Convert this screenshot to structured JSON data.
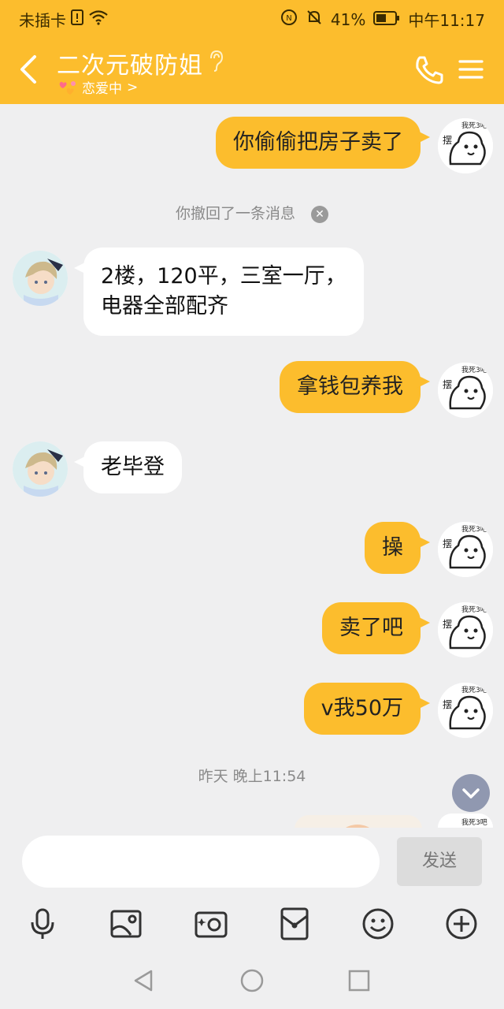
{
  "status_bar": {
    "carrier": "未插卡",
    "battery_pct": "41%",
    "time": "中午11:17"
  },
  "header": {
    "title": "二次元破防姐",
    "status": "恋爱中",
    "status_chevron": ">"
  },
  "messages": [
    {
      "side": "me",
      "text": "你偷偷把房子卖了"
    },
    {
      "side": "system",
      "text": "你撤回了一条消息"
    },
    {
      "side": "other",
      "line1": "2楼，120平，三室一厅，",
      "line2": "电器全部配齐"
    },
    {
      "side": "me",
      "text": "拿钱包养我"
    },
    {
      "side": "other",
      "text": "老毕登"
    },
    {
      "side": "me",
      "text": "操"
    },
    {
      "side": "me",
      "text": "卖了吧"
    },
    {
      "side": "me",
      "text": "v我50万"
    },
    {
      "side": "system",
      "text": "昨天 晚上11:54"
    }
  ],
  "input": {
    "placeholder": "",
    "send_label": "发送"
  },
  "toolbar_icons": [
    "microphone-icon",
    "image-icon",
    "camera-icon",
    "red-packet-icon",
    "emoji-icon",
    "plus-icon"
  ],
  "colors": {
    "accent": "#fcbd2d",
    "background": "#efeff0",
    "bubble_other": "#ffffff"
  }
}
